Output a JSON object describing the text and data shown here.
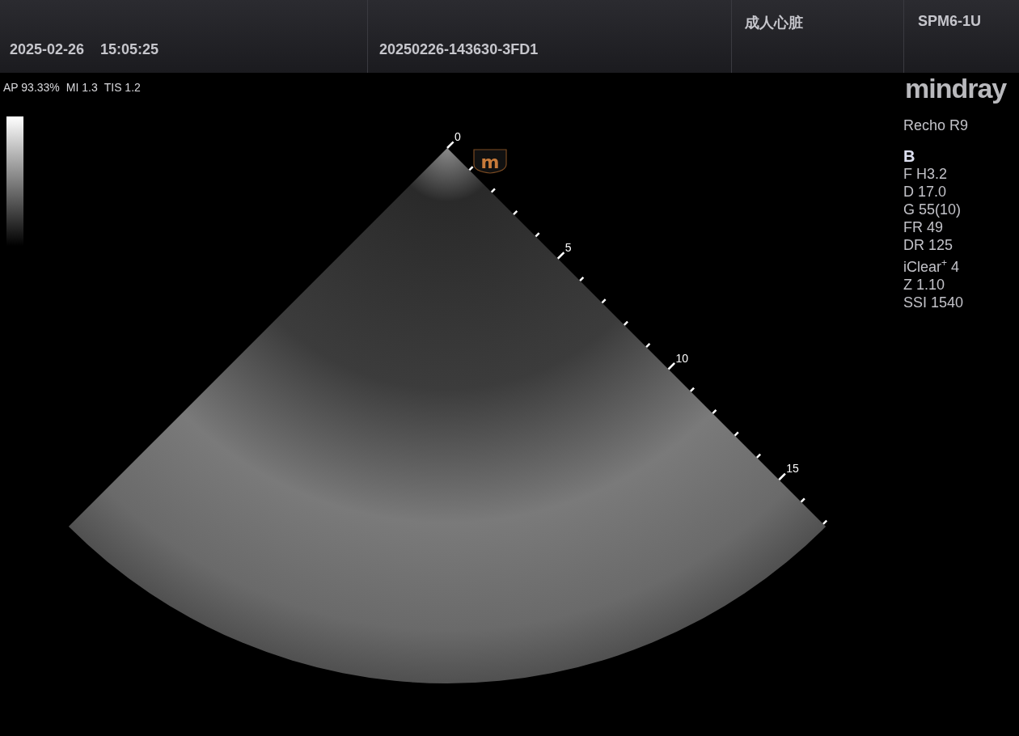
{
  "header": {
    "date": "2025-02-26",
    "time": "15:05:25",
    "exam_id": "20250226-143630-3FD1",
    "preset": "成人心脏",
    "probe": "SPM6-1U"
  },
  "acoustic_output": [
    "AP 93.33%",
    "MI 1.3",
    "TIS 1.2"
  ],
  "logo": "mindray",
  "system": "Recho R9",
  "mode": "B",
  "parameters": [
    "F H3.2",
    "D 17.0",
    "G 55(10)",
    "FR 49",
    "DR 125",
    "iClear$^{+}$ 4",
    "Z 1.10",
    "SSI 1540"
  ],
  "image": {
    "orientation_marker": "m",
    "depth_labels": [
      "0",
      "5",
      "10",
      "15"
    ]
  }
}
